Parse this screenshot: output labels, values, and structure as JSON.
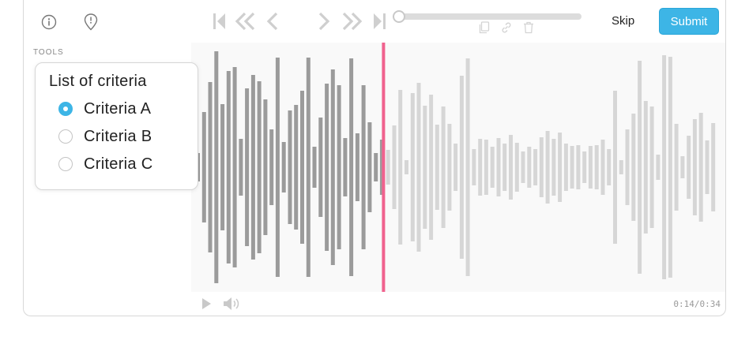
{
  "toolbar": {
    "skip_label": "Skip",
    "submit_label": "Submit",
    "progress_fraction": 0.0
  },
  "sidebar": {
    "tools_label": "TOOLS"
  },
  "criteria": {
    "title": "List of criteria",
    "options": [
      {
        "label": "Criteria A",
        "selected": true
      },
      {
        "label": "Criteria B",
        "selected": false
      },
      {
        "label": "Criteria C",
        "selected": false
      }
    ]
  },
  "player": {
    "time": "0:14/0:34",
    "played_fraction": 0.36
  },
  "colors": {
    "accent": "#3db5e6",
    "playhead": "#f0628e",
    "played_bar": "#9b9b9b",
    "unplayed_bar": "#d6d6d6"
  },
  "icons": [
    "info-icon",
    "alert-pin-icon",
    "skip-start-icon",
    "rewind-icon",
    "step-back-icon",
    "step-forward-icon",
    "fast-forward-icon",
    "skip-end-icon",
    "copy-icon",
    "link-icon",
    "trash-icon",
    "play-icon",
    "volume-icon"
  ]
}
